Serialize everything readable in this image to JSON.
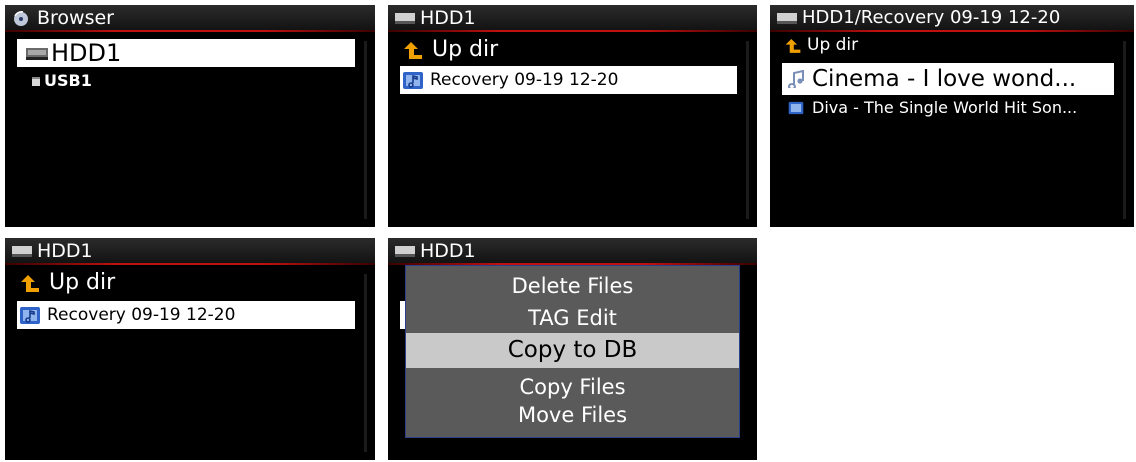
{
  "screens": [
    {
      "title": "Browser",
      "title_icon": "disc-icon",
      "items": [
        {
          "label": "HDD1",
          "icon": "drive-icon",
          "selected": true
        },
        {
          "label": "USB1",
          "icon": "usb-icon",
          "selected": false
        }
      ]
    },
    {
      "title": "HDD1",
      "title_icon": "drive-icon",
      "items": [
        {
          "label": "Up dir",
          "icon": "up-arrow-icon",
          "selected": false
        },
        {
          "label": "Recovery 09-19 12-20",
          "icon": "folder-icon",
          "selected": true
        }
      ]
    },
    {
      "title": "HDD1/Recovery 09-19 12-20",
      "title_icon": "drive-icon",
      "items": [
        {
          "label": "Up dir",
          "icon": "up-arrow-icon",
          "selected": false
        },
        {
          "label": "Cinema - I love wond...",
          "icon": "music-note-icon",
          "selected": true
        },
        {
          "label": "Diva - The Single World Hit Son...",
          "icon": "music-file-icon",
          "selected": false
        }
      ]
    },
    {
      "title": "HDD1",
      "title_icon": "drive-icon",
      "items": [
        {
          "label": "Up dir",
          "icon": "up-arrow-icon",
          "selected": false
        },
        {
          "label": "Recovery 09-19 12-20",
          "icon": "folder-icon",
          "selected": true
        }
      ]
    },
    {
      "title": "HDD1",
      "title_icon": "drive-icon",
      "menu": {
        "items": [
          "Delete Files",
          "TAG Edit",
          "Copy to DB",
          "Copy Files",
          "Move Files"
        ],
        "highlighted": "Copy to DB"
      }
    }
  ],
  "colors": {
    "screen_bg": "#000000",
    "title_underline": "#c01010",
    "selection_bg": "#ffffff",
    "menu_bg": "#5a5a5a",
    "menu_highlight": "#c9c9c9",
    "up_arrow": "#f0a000",
    "folder_icon": "#2f63c8"
  }
}
